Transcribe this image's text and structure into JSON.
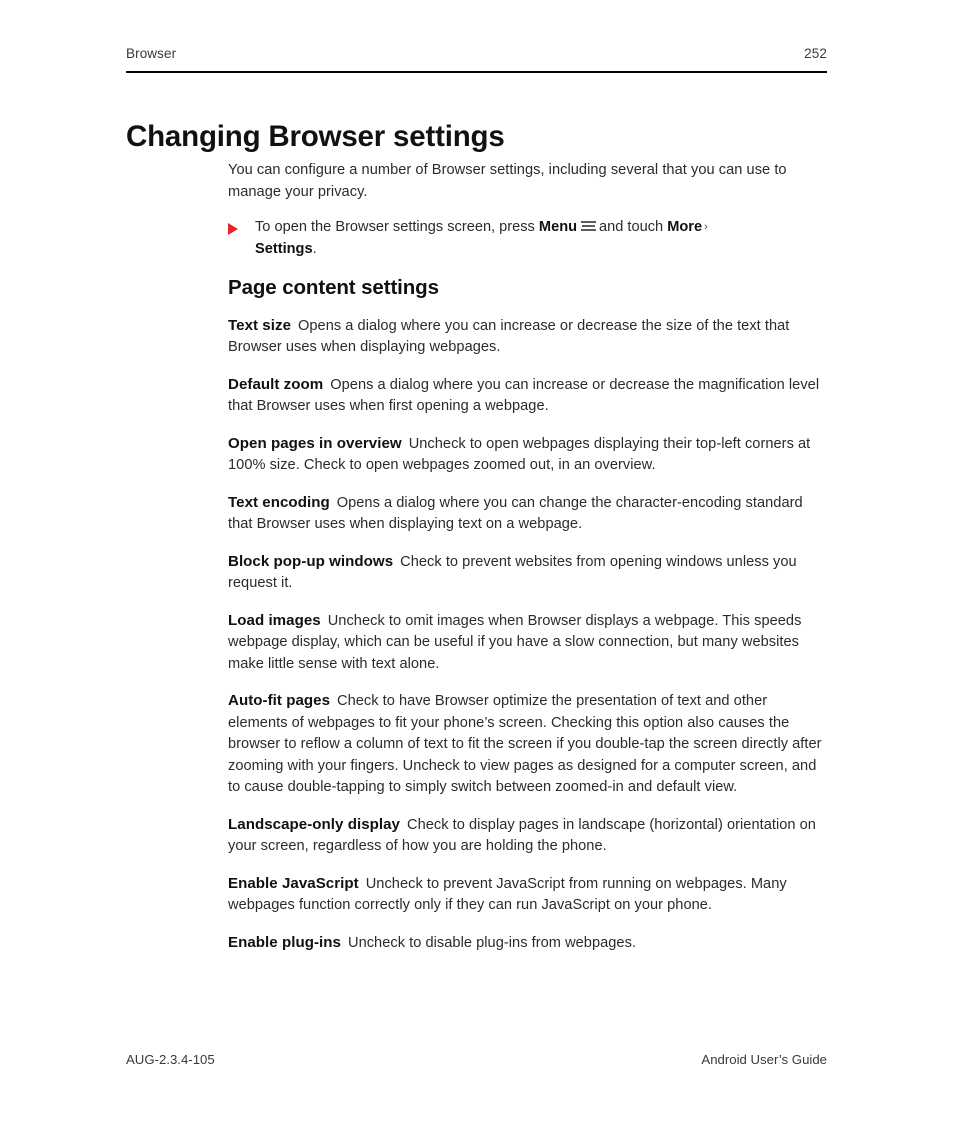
{
  "header": {
    "chapter_label": "Browser",
    "page_number": "252"
  },
  "title": "Changing Browser settings",
  "intro": {
    "paragraph": "You can configure a number of Browser settings, including several that you can use to manage your privacy."
  },
  "step": {
    "text_before_menu": "To open the Browser settings screen, press ",
    "menu_label": "Menu",
    "menu_icon": "menu-icon",
    "text_after_icon": "and touch ",
    "more_label": "More",
    "chevron": "›",
    "settings_label": "Settings",
    "period": "."
  },
  "section": {
    "heading": "Page content settings",
    "entries": [
      {
        "term": "Text size",
        "description": "Opens a dialog where you can increase or decrease the size of the text that Browser uses when displaying webpages."
      },
      {
        "term": "Default zoom",
        "description": "Opens a dialog where you can increase or decrease the magnification level that Browser uses when first opening a webpage."
      },
      {
        "term": "Open pages in overview",
        "description": "Uncheck to open webpages displaying their top-left corners at 100% size. Check to open webpages zoomed out, in an overview."
      },
      {
        "term": "Text encoding",
        "description": "Opens a dialog where you can change the character-encoding standard that Browser uses when displaying text on a webpage."
      },
      {
        "term": "Block pop-up windows",
        "description": "Check to prevent websites from opening windows unless you request it."
      },
      {
        "term": "Load images",
        "description": "Uncheck to omit images when Browser displays a webpage. This speeds webpage display, which can be useful if you have a slow connection, but many websites make little sense with text alone."
      },
      {
        "term": "Auto-fit pages",
        "description": "Check to have Browser optimize the presentation of text and other elements of webpages to fit your phone’s screen. Checking this option also causes the browser to reflow a column of text to fit the screen if you double-tap the screen directly after zooming with your fingers. Uncheck to view pages as designed for a computer screen, and to cause double-tapping to simply switch between zoomed-in and default view."
      },
      {
        "term": "Landscape-only display",
        "description": "Check to display pages in landscape (horizontal) orientation on your screen, regardless of how you are holding the phone."
      },
      {
        "term": "Enable JavaScript",
        "description": "Uncheck to prevent JavaScript from running on webpages. Many webpages function correctly only if they can run JavaScript on your phone."
      },
      {
        "term": "Enable plug-ins",
        "description": "Uncheck to disable plug-ins from webpages."
      }
    ]
  },
  "footer": {
    "doc_code": "AUG-2.3.4-105",
    "doc_title": "Android User’s Guide"
  },
  "colors": {
    "bullet_red": "#e8232a",
    "rule_black": "#000000",
    "body_text": "#2b2b2b"
  }
}
